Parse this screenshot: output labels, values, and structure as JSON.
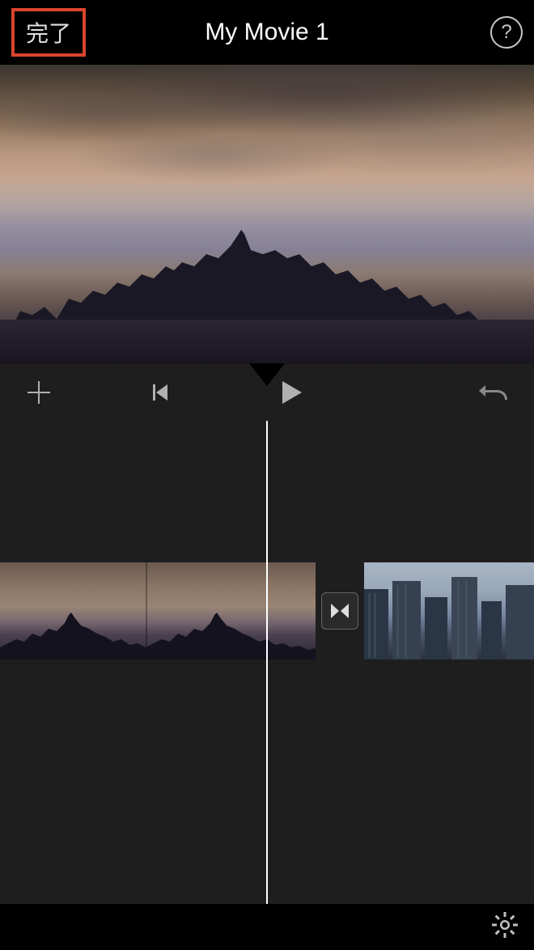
{
  "header": {
    "done_label": "完了",
    "title": "My Movie 1",
    "help_label": "?"
  },
  "controls": {
    "add_icon": "plus-icon",
    "prev_icon": "previous-icon",
    "play_icon": "play-icon",
    "undo_icon": "undo-icon"
  },
  "timeline": {
    "clips": [
      {
        "id": "clip-1",
        "type": "skyline-dusk"
      },
      {
        "id": "clip-2",
        "type": "city-towers"
      }
    ],
    "transition_icon": "crossfade-icon"
  },
  "footer": {
    "settings_icon": "gear-icon"
  },
  "colors": {
    "highlight": "#d9452c",
    "background": "#1e1e1e",
    "icon": "#b0b0b0"
  }
}
